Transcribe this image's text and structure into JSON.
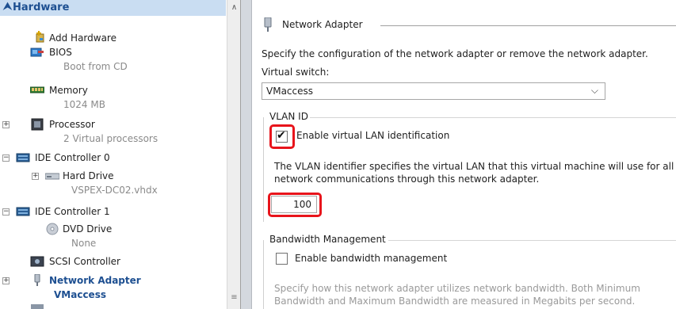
{
  "hardware": {
    "title": "Hardware",
    "items": [
      {
        "label": "Add Hardware"
      },
      {
        "label": "BIOS",
        "sub": "Boot from CD"
      },
      {
        "label": "Memory",
        "sub": "1024 MB"
      },
      {
        "label": "Processor",
        "sub": "2 Virtual processors"
      },
      {
        "label": "IDE Controller 0"
      },
      {
        "label": "Hard Drive",
        "sub": "VSPEX-DC02.vhdx"
      },
      {
        "label": "IDE Controller 1"
      },
      {
        "label": "DVD Drive",
        "sub": "None"
      },
      {
        "label": "SCSI Controller"
      },
      {
        "label": "Network Adapter",
        "sub": "VMaccess"
      }
    ]
  },
  "adapter": {
    "title": "Network Adapter",
    "description": "Specify the configuration of the network adapter or remove the network adapter.",
    "switch_label": "Virtual switch:",
    "switch_value": "VMaccess",
    "vlan": {
      "group_label": "VLAN ID",
      "checkbox_label": "Enable virtual LAN identification",
      "checked": true,
      "help_line1": "The VLAN identifier specifies the virtual LAN that this virtual machine will use for all",
      "help_line2": "network communications through this network adapter.",
      "value": "100"
    },
    "bandwidth": {
      "group_label": "Bandwidth Management",
      "checkbox_label": "Enable bandwidth management",
      "checked": false,
      "help_line1": "Specify how this network adapter utilizes network bandwidth. Both Minimum",
      "help_line2": "Bandwidth and Maximum Bandwidth are measured in Megabits per second."
    }
  },
  "colors": {
    "selection": "#1d4f91",
    "highlight": "#e8141b",
    "header_bg": "#c9ddf2"
  }
}
